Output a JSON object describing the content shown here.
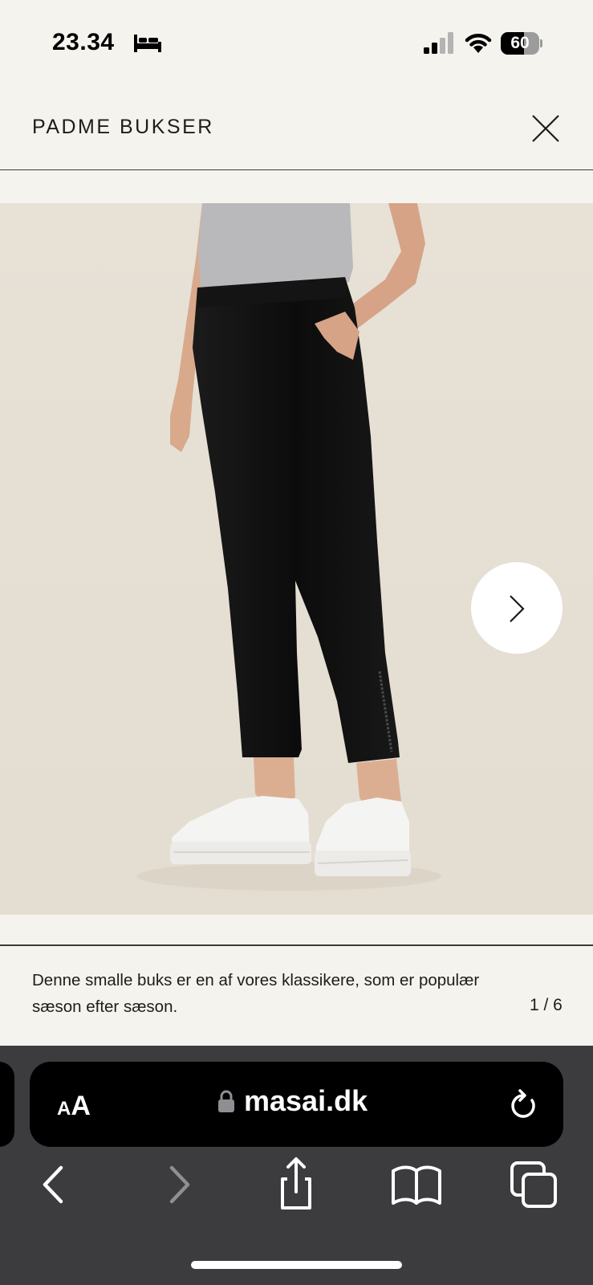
{
  "status_bar": {
    "time": "23.34",
    "battery_percent": "60",
    "battery_level": 0.6,
    "icons": [
      "bed-icon",
      "cellular-signal-icon",
      "wifi-icon",
      "battery-icon"
    ]
  },
  "header": {
    "title": "PADME BUKSER",
    "close_icon": "close-icon"
  },
  "gallery": {
    "image_subject": "black trousers on model",
    "next_icon": "chevron-right-icon",
    "counter": "1 / 6"
  },
  "description": {
    "text": "Denne smalle buks er en af vores klassikere, som er populær sæson efter sæson."
  },
  "browser": {
    "aa_small": "A",
    "aa_large": "A",
    "url": "masai.dk",
    "nav_icons": [
      "back-icon",
      "forward-icon",
      "share-icon",
      "bookmarks-icon",
      "tabs-icon"
    ]
  },
  "colors": {
    "page_bg": "#f5f3ee",
    "image_bg": "#e6dfd3",
    "text": "#1d1d1b",
    "browser_bg": "#3c3c3e"
  }
}
